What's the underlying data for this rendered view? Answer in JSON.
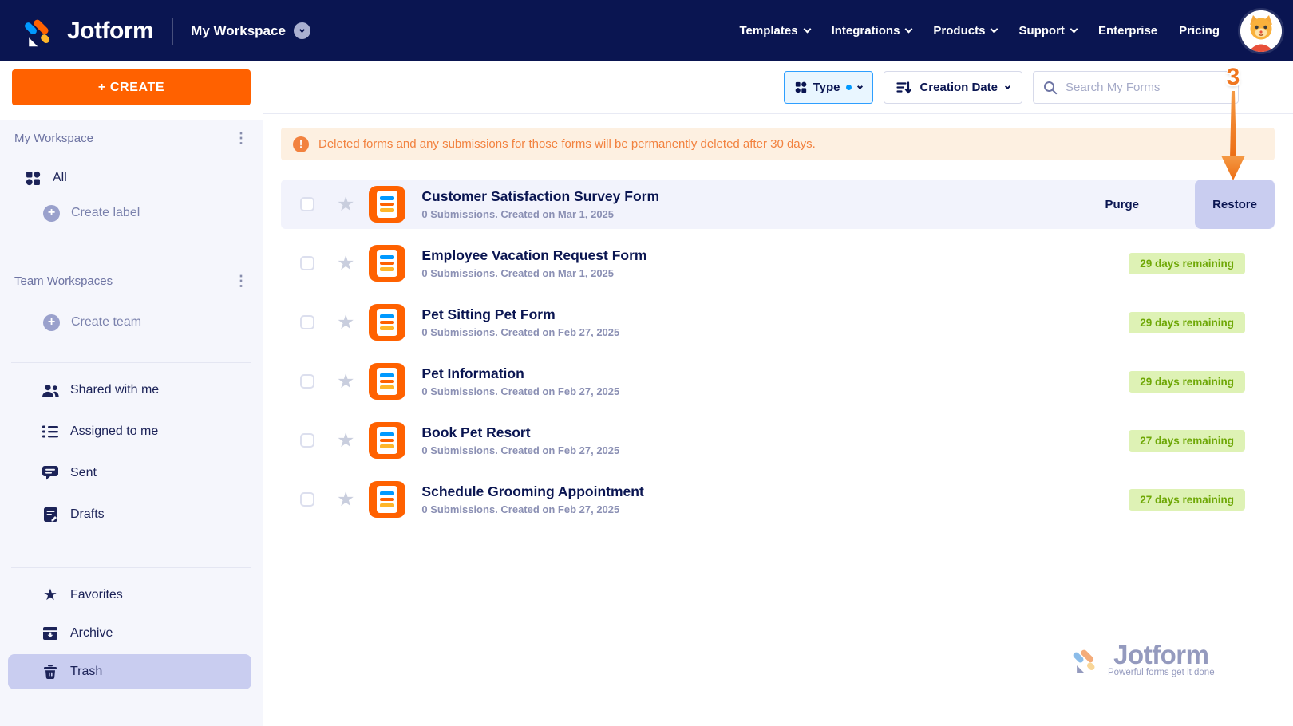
{
  "header": {
    "brand": "Jotform",
    "workspace_label": "My Workspace",
    "nav": [
      {
        "label": "Templates",
        "dropdown": true
      },
      {
        "label": "Integrations",
        "dropdown": true
      },
      {
        "label": "Products",
        "dropdown": true
      },
      {
        "label": "Support",
        "dropdown": true
      },
      {
        "label": "Enterprise",
        "dropdown": false
      },
      {
        "label": "Pricing",
        "dropdown": false
      }
    ]
  },
  "sidebar": {
    "create_button_label": "+ CREATE",
    "my_workspace_header": "My Workspace",
    "all_label": "All",
    "create_label_label": "Create label",
    "team_workspaces_header": "Team Workspaces",
    "create_team_label": "Create team",
    "items": {
      "shared": "Shared with me",
      "assigned": "Assigned to me",
      "sent": "Sent",
      "drafts": "Drafts",
      "favorites": "Favorites",
      "archive": "Archive",
      "trash": "Trash"
    },
    "selected_item": "Trash"
  },
  "toolbar": {
    "type_label": "Type",
    "sort_label": "Creation Date",
    "search_placeholder": "Search My Forms"
  },
  "banner": {
    "text": "Deleted forms and any submissions for those forms will be permanently deleted after 30 days."
  },
  "forms": {
    "rows": [
      {
        "title": "Customer Satisfaction Survey Form",
        "meta": "0 Submissions. Created on Mar 1, 2025",
        "state": "hovered",
        "purge_label": "Purge",
        "restore_label": "Restore"
      },
      {
        "title": "Employee Vacation Request Form",
        "meta": "0 Submissions. Created on Mar 1, 2025",
        "badge": "29 days remaining"
      },
      {
        "title": "Pet Sitting Pet Form",
        "meta": "0 Submissions. Created on Feb 27, 2025",
        "badge": "29 days remaining"
      },
      {
        "title": "Pet Information",
        "meta": "0 Submissions. Created on Feb 27, 2025",
        "badge": "29 days remaining"
      },
      {
        "title": "Book Pet Resort",
        "meta": "0 Submissions. Created on Feb 27, 2025",
        "badge": "27 days remaining"
      },
      {
        "title": "Schedule Grooming Appointment",
        "meta": "0 Submissions. Created on Feb 27, 2025",
        "badge": "27 days remaining"
      }
    ]
  },
  "annotation": {
    "step": "3"
  },
  "watermark": {
    "brand": "Jotform",
    "tagline": "Powerful forms get it done"
  },
  "colors": {
    "navy": "#0a1551",
    "orange": "#ff6100",
    "blue": "#0099ff",
    "yellow": "#ffb629",
    "badge_bg": "#def2b5",
    "badge_text": "#6fa807",
    "banner_bg": "#fdf0e1",
    "banner_text": "#f2823f",
    "selected_bg": "#c9cdf0",
    "row_hover": "#f2f3fc",
    "annotation": "#f0761f",
    "watermark_text": "#8f95bb"
  }
}
